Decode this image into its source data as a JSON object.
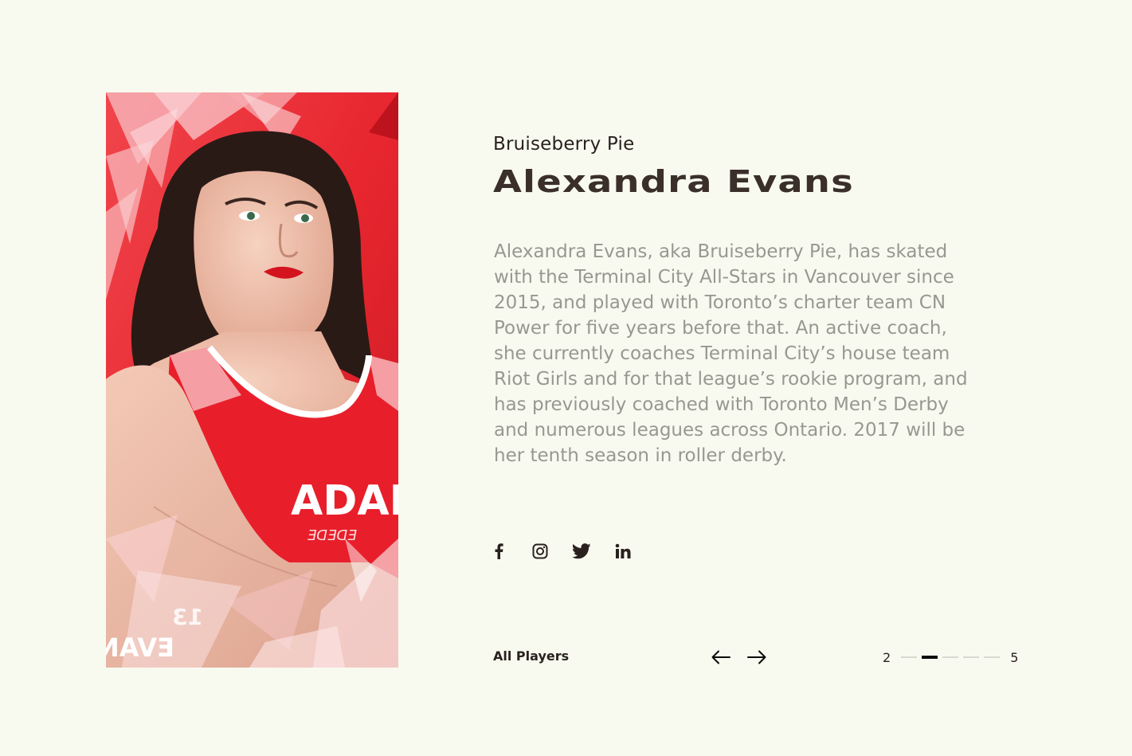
{
  "player": {
    "nickname": "Bruiseberry Pie",
    "name": "Alexandra Evans",
    "bio": "Alexandra Evans, aka Bruiseberry Pie, has skated with the Terminal City All-Stars in Vancouver since 2015, and played with Toronto’s charter team CN Power for five years before that. An active coach, she currently coaches Terminal City’s house team Riot Girls and for that league’s rookie program, and has previously coached with Toronto Men’s Derby and numerous leagues across Ontario. 2017 will be her tenth season in roller derby.",
    "photo": {
      "jersey_text": "ADAN",
      "jersey_subtext": "ƎᗡƎᗡƎ",
      "corner_number": "13",
      "corner_name": "EVAN"
    }
  },
  "social": [
    {
      "icon": "facebook-icon"
    },
    {
      "icon": "instagram-icon"
    },
    {
      "icon": "twitter-icon"
    },
    {
      "icon": "linkedin-icon"
    }
  ],
  "footer": {
    "all_players_label": "All Players",
    "prev_icon": "arrow-left-icon",
    "next_icon": "arrow-right-icon"
  },
  "pagination": {
    "current": "2",
    "total": "5",
    "active_index": 1,
    "dash_count": 5
  },
  "colors": {
    "background": "#f8faf0",
    "heading": "#3b2f2a",
    "body_text": "#979891",
    "photo_red": "#e8262f"
  }
}
